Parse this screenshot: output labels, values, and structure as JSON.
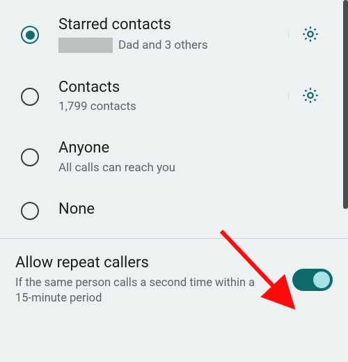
{
  "options": [
    {
      "title": "Starred contacts",
      "sub_suffix": "Dad and 3 others",
      "selected": true,
      "has_gear": true,
      "has_redact": true
    },
    {
      "title": "Contacts",
      "sub": "1,799 contacts",
      "selected": false,
      "has_gear": true
    },
    {
      "title": "Anyone",
      "sub": "All calls can reach you",
      "selected": false,
      "has_gear": false
    },
    {
      "title": "None",
      "selected": false,
      "has_gear": false
    }
  ],
  "repeat": {
    "title": "Allow repeat callers",
    "desc": "If the same person calls a second time within a 15-minute period",
    "enabled": true
  },
  "colors": {
    "accent": "#106c6c",
    "arrow": "#ff0b0b"
  }
}
